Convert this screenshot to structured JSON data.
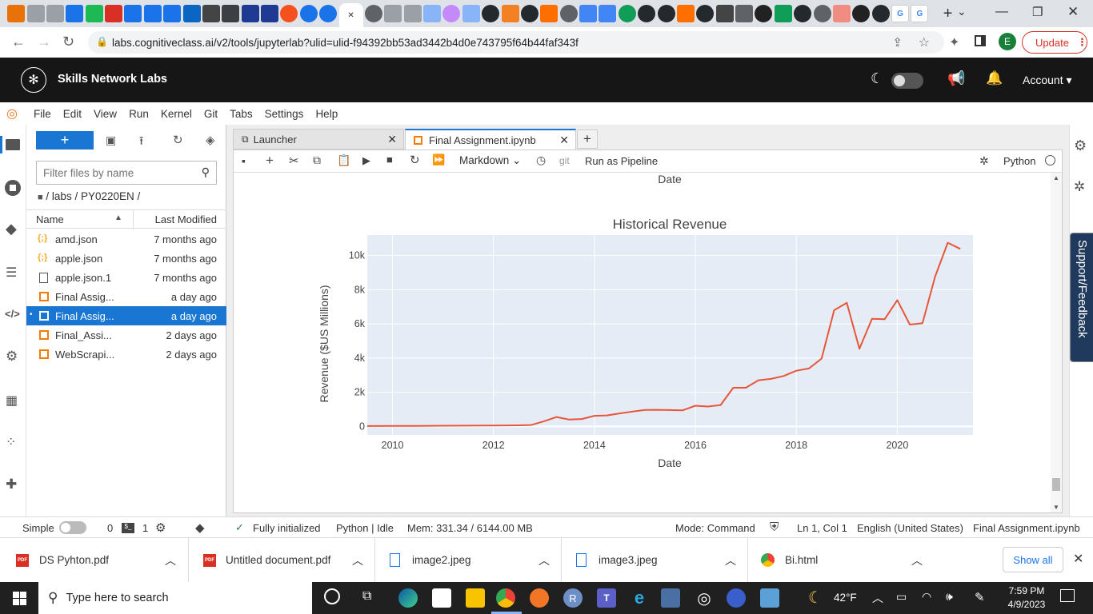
{
  "browser": {
    "url": "labs.cognitiveclass.ai/v2/tools/jupyterlab?ulid=ulid-f94392bb53ad3442b4d0e743795f64b44faf343f",
    "profile_initial": "E",
    "update_label": "Update"
  },
  "snl": {
    "title": "Skills Network Labs",
    "account_label": "Account"
  },
  "menu": [
    "File",
    "Edit",
    "View",
    "Run",
    "Kernel",
    "Git",
    "Tabs",
    "Settings",
    "Help"
  ],
  "filebrowser": {
    "filter_placeholder": "Filter files by name",
    "breadcrumb": "/ labs / PY0220EN /",
    "col_name": "Name",
    "col_modified": "Last Modified",
    "files": [
      {
        "name": "amd.json",
        "modified": "7 months ago",
        "type": "json"
      },
      {
        "name": "apple.json",
        "modified": "7 months ago",
        "type": "json"
      },
      {
        "name": "apple.json.1",
        "modified": "7 months ago",
        "type": "file"
      },
      {
        "name": "Final Assig...",
        "modified": "a day ago",
        "type": "notebook"
      },
      {
        "name": "Final Assig...",
        "modified": "a day ago",
        "type": "notebook"
      },
      {
        "name": "Final_Assi...",
        "modified": "2 days ago",
        "type": "notebook"
      },
      {
        "name": "WebScrapi...",
        "modified": "2 days ago",
        "type": "notebook"
      }
    ]
  },
  "tabs": {
    "launcher": "Launcher",
    "notebook": "Final Assignment.ipynb"
  },
  "toolbar": {
    "cell_type": "Markdown",
    "git_label": "git",
    "pipeline": "Run as Pipeline",
    "kernel": "Python"
  },
  "chart_data": {
    "type": "line",
    "title": "Historical Revenue",
    "xlabel": "Date",
    "ylabel": "Revenue ($US Millions)",
    "top_axis_label": "Date",
    "xlim": [
      2009.5,
      2021.5
    ],
    "ylim": [
      -500,
      11200
    ],
    "xticks": [
      2010,
      2012,
      2014,
      2016,
      2018,
      2020
    ],
    "yticks": [
      0,
      2000,
      4000,
      6000,
      8000,
      10000
    ],
    "ytick_labels": [
      "0",
      "2k",
      "4k",
      "6k",
      "8k",
      "10k"
    ],
    "grid": true,
    "line_color": "#e8563a",
    "plot_bg": "#e5ecf6",
    "series": [
      {
        "x": [
          2009.5,
          2010,
          2010.5,
          2011,
          2011.5,
          2012,
          2012.5,
          2012.75,
          2013,
          2013.25,
          2013.5,
          2013.75,
          2014,
          2014.25,
          2014.5,
          2014.75,
          2015,
          2015.25,
          2015.5,
          2015.75,
          2016,
          2016.25,
          2016.5,
          2016.75,
          2017,
          2017.25,
          2017.5,
          2017.75,
          2018,
          2018.25,
          2018.5,
          2018.75,
          2019,
          2019.25,
          2019.5,
          2019.75,
          2020,
          2020.25,
          2020.5,
          2020.75,
          2021,
          2021.25
        ],
        "y": [
          20,
          25,
          30,
          40,
          45,
          50,
          60,
          80,
          300,
          550,
          400,
          430,
          620,
          640,
          760,
          860,
          960,
          970,
          955,
          940,
          1210,
          1160,
          1250,
          2260,
          2260,
          2700,
          2780,
          2950,
          3260,
          3390,
          3970,
          6800,
          7230,
          4540,
          6300,
          6270,
          7390,
          5960,
          6040,
          8770,
          10750,
          10390
        ]
      }
    ]
  },
  "status": {
    "mode_label": "Simple",
    "terminals": "0",
    "kernels": "1",
    "init": "Fully initialized",
    "kernel_state": "Python | Idle",
    "mem": "Mem: 331.34 / 6144.00 MB",
    "cmd_mode": "Mode: Command",
    "cursor": "Ln 1, Col 1",
    "lang": "English (United States)",
    "file": "Final Assignment.ipynb"
  },
  "downloads": {
    "items": [
      "DS Pyhton.pdf",
      "Untitled document.pdf",
      "image2.jpeg",
      "image3.jpeg",
      "Bi.html"
    ],
    "show_all": "Show all"
  },
  "taskbar": {
    "search_placeholder": "Type here to search",
    "temp": "42°F",
    "time": "7:59 PM",
    "date": "4/9/2023"
  },
  "side": {
    "support": "Support/Feedback"
  }
}
